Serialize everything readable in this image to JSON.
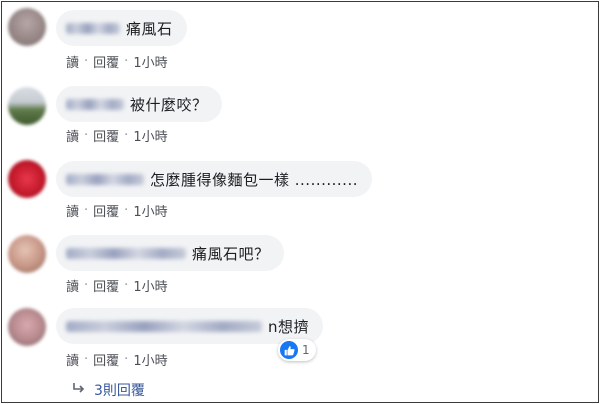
{
  "colors": {
    "bubble": "#f2f3f5",
    "meta_text": "#4b4f56",
    "link": "#385898",
    "like_blue": "#1877f2"
  },
  "comments": [
    {
      "text": "痛風石",
      "actions": {
        "read": "讀",
        "reply": "回覆",
        "time": "1小時"
      }
    },
    {
      "text": "被什麼咬？",
      "actions": {
        "read": "讀",
        "reply": "回覆",
        "time": "1小時"
      }
    },
    {
      "text": "怎麼腫得像麵包一樣 ............",
      "actions": {
        "read": "讀",
        "reply": "回覆",
        "time": "1小時"
      }
    },
    {
      "text": "痛風石吧？",
      "actions": {
        "read": "讀",
        "reply": "回覆",
        "time": "1小時"
      }
    },
    {
      "text": "n想擠",
      "actions": {
        "read": "讀",
        "reply": "回覆",
        "time": "1小時"
      },
      "reaction": {
        "icon": "like-icon",
        "count": "1"
      }
    }
  ],
  "replies_link": {
    "icon": "reply-arrow-icon",
    "label": "3則回覆"
  }
}
